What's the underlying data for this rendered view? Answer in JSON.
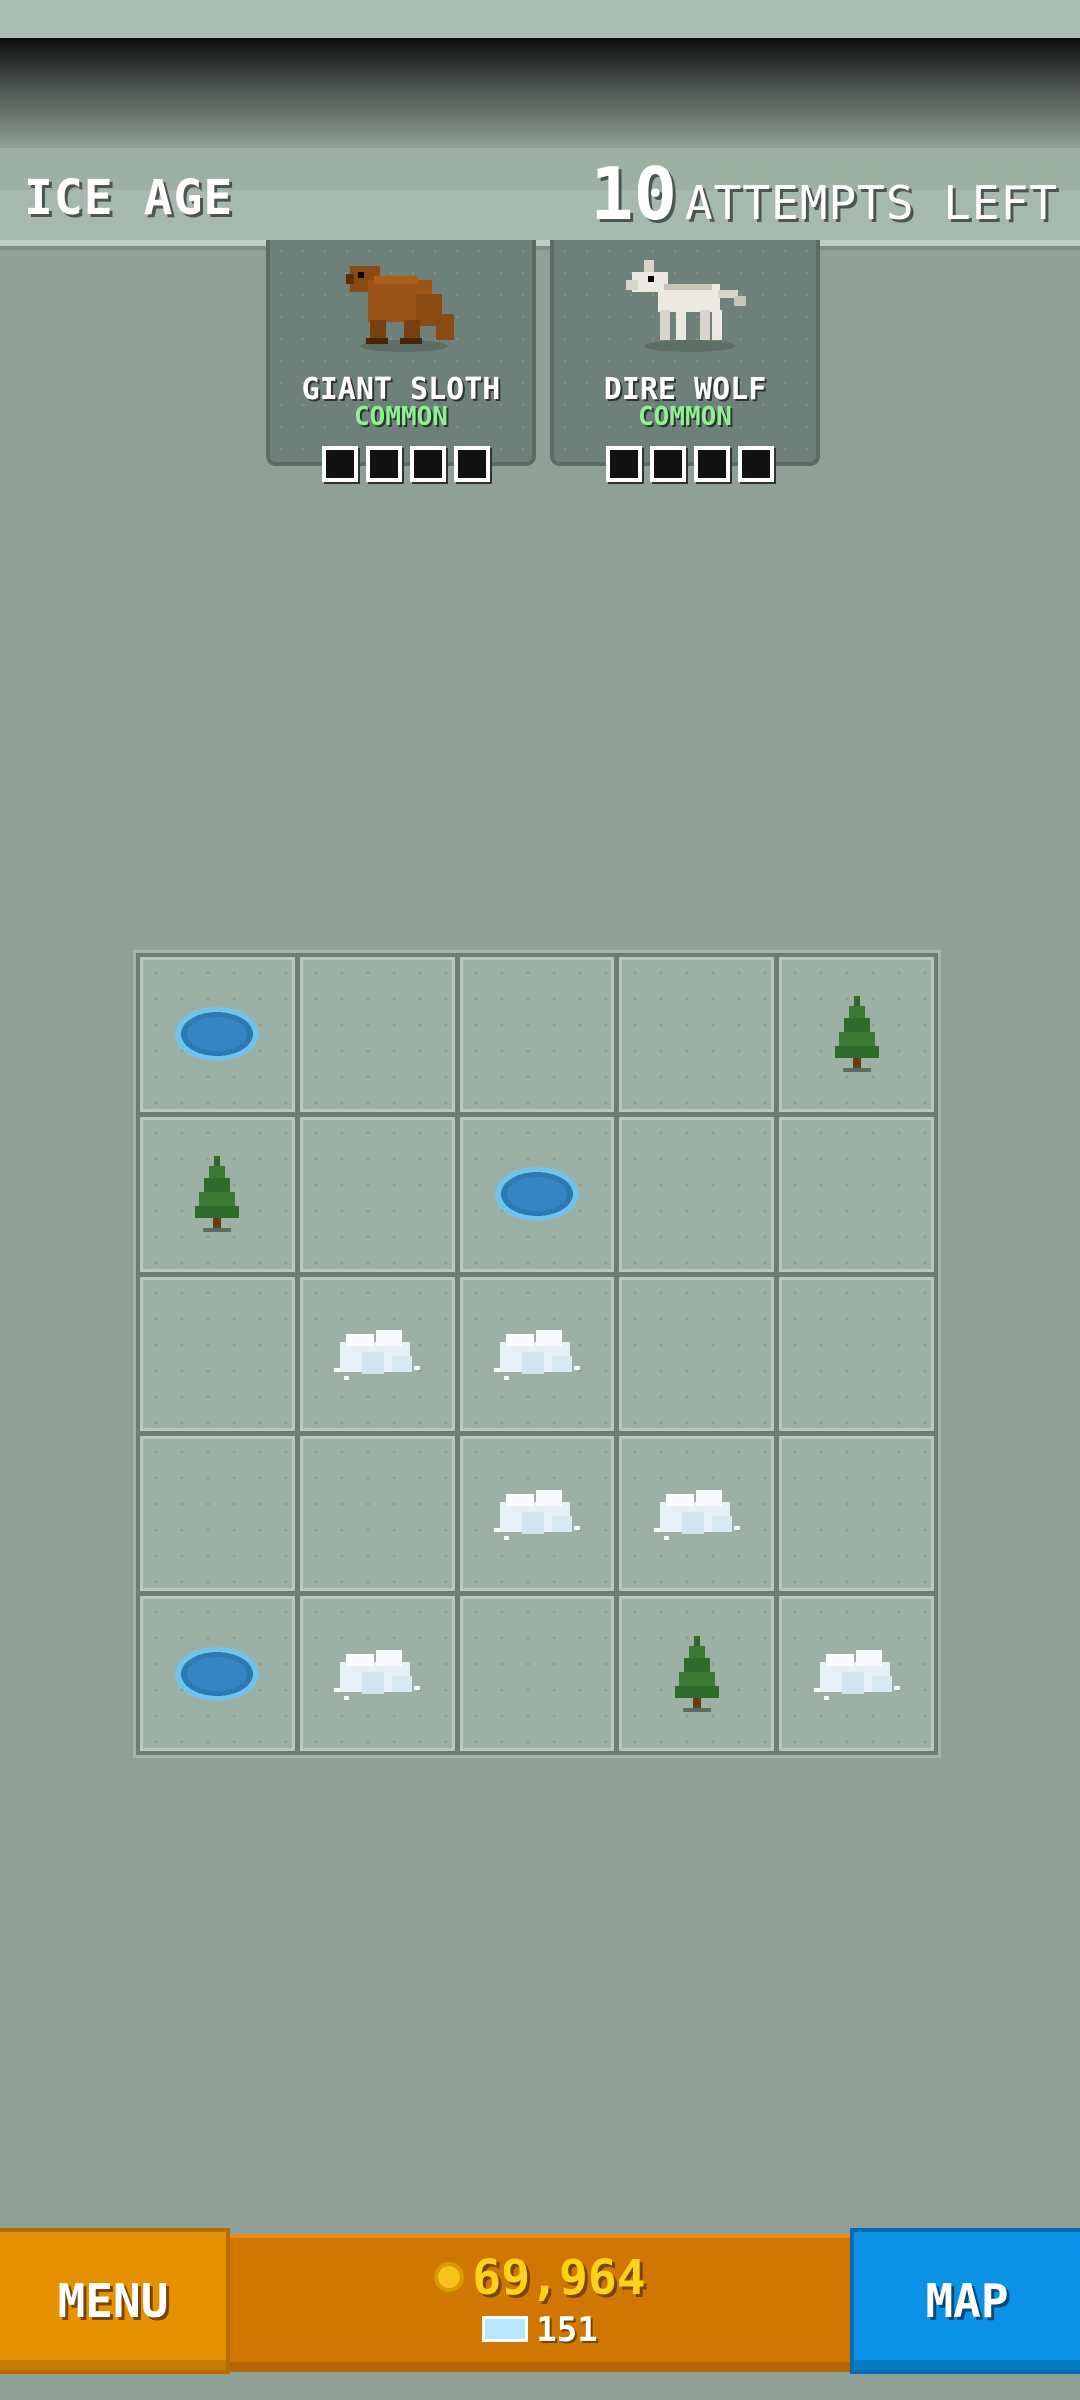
{
  "header": {
    "era_title": "ICE AGE",
    "attempts_count": "10",
    "attempts_label": "ATTEMPTS LEFT"
  },
  "targets": [
    {
      "name": "GIANT SLOTH",
      "rarity": "COMMON",
      "icon": "giant-sloth-icon",
      "slots": 4
    },
    {
      "name": "DIRE WOLF",
      "rarity": "COMMON",
      "icon": "dire-wolf-icon",
      "slots": 4
    }
  ],
  "grid": {
    "rows": 5,
    "cols": 5,
    "tiles": [
      [
        "pond",
        "empty",
        "empty",
        "empty",
        "tree"
      ],
      [
        "tree",
        "empty",
        "pond",
        "empty",
        "empty"
      ],
      [
        "empty",
        "snow",
        "snow",
        "empty",
        "empty"
      ],
      [
        "empty",
        "empty",
        "snow",
        "snow",
        "empty"
      ],
      [
        "pond",
        "snow",
        "empty",
        "tree",
        "snow"
      ]
    ]
  },
  "footer": {
    "menu_label": "MENU",
    "coins": "69,964",
    "gems": "151",
    "map_label": "MAP"
  },
  "colors": {
    "background": "#8fa196",
    "menu": "#e69100",
    "map": "#0a93e6",
    "coin_text": "#ffd21a",
    "rarity_common": "#8ff08f"
  }
}
